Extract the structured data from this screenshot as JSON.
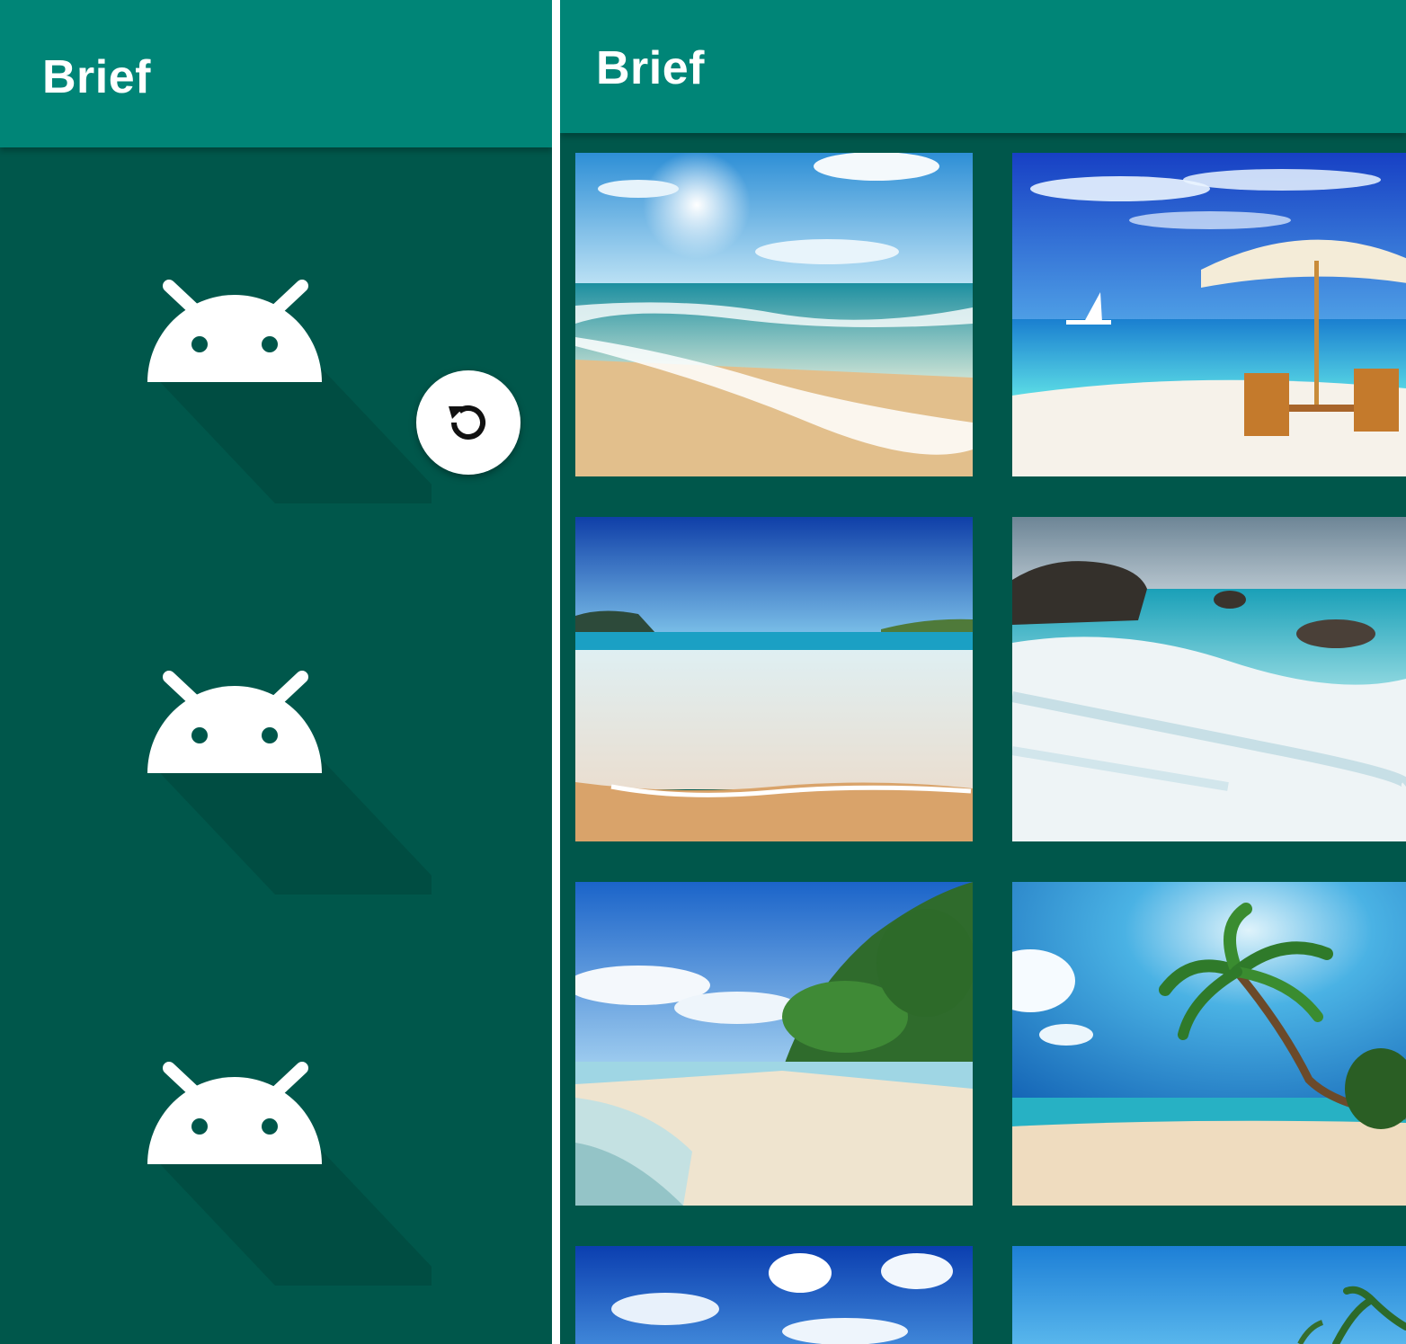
{
  "left_screen": {
    "app_title": "Brief",
    "placeholder_icon": "android-icon",
    "refresh_icon": "refresh-icon"
  },
  "right_screen": {
    "app_title": "Brief",
    "thumbnails": [
      {
        "subject": "beach-sun-waves"
      },
      {
        "subject": "beach-umbrella-chairs"
      },
      {
        "subject": "beach-shore-waves"
      },
      {
        "subject": "beach-rocks-surf"
      },
      {
        "subject": "beach-trees-sand"
      },
      {
        "subject": "beach-palm-tree"
      },
      {
        "subject": "beach-sky-clouds"
      },
      {
        "subject": "beach-palms-sky"
      }
    ]
  },
  "colors": {
    "appbar": "#008577",
    "background": "#00574b",
    "icon": "#ffffff"
  }
}
